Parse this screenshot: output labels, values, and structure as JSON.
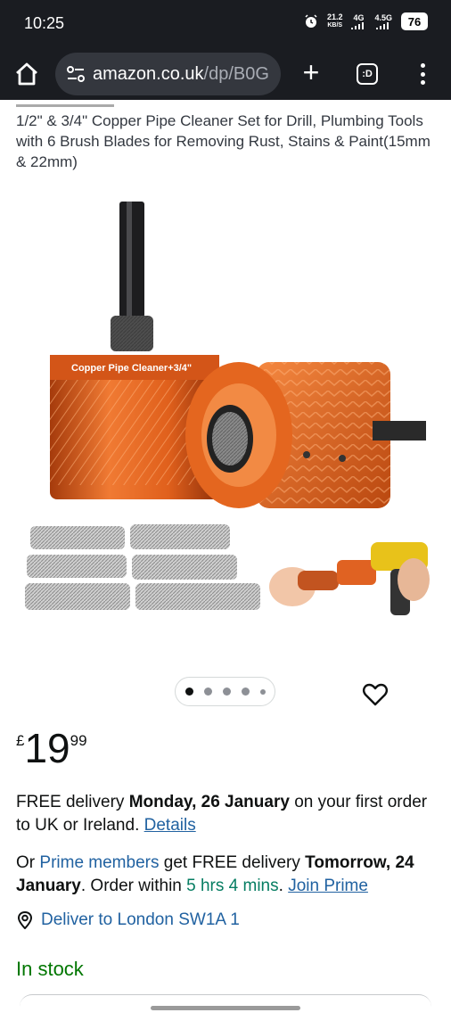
{
  "status_bar": {
    "time": "10:25",
    "net_speed_value": "21.2",
    "net_speed_unit": "KB/S",
    "signal1_label": "4G",
    "signal2_label": "4.5G",
    "battery": "76"
  },
  "browser": {
    "url_main": "amazon.co.uk",
    "url_path": "/dp/B0G",
    "tabs_label": ":D"
  },
  "product": {
    "title": "1/2\" & 3/4\" Copper Pipe Cleaner Set for Drill, Plumbing Tools with 6 Brush Blades for Removing Rust, Stains & Paint(15mm & 22mm)",
    "image_label": "Copper Pipe Cleaner+3/4\"",
    "price_symbol": "£",
    "price_whole": "19",
    "price_fraction": "99",
    "image_count": 5,
    "active_image": 1
  },
  "delivery": {
    "prefix": "FREE delivery ",
    "date": "Monday, 26 January",
    "suffix": " on your first order to UK or Ireland. ",
    "details_link": "Details"
  },
  "prime": {
    "prefix": "Or ",
    "members_link": "Prime members",
    "middle": " get FREE delivery ",
    "date": "Tomorrow, 24 January",
    "order_within": ". Order within ",
    "countdown": "5 hrs 4 mins",
    "dot": ". ",
    "join_link": "Join Prime"
  },
  "location": {
    "deliver_to": "Deliver to London SW1A 1"
  },
  "availability": "In stock",
  "colors": {
    "link": "#2162a1",
    "stock": "#007600",
    "copper": "#e0601c"
  }
}
